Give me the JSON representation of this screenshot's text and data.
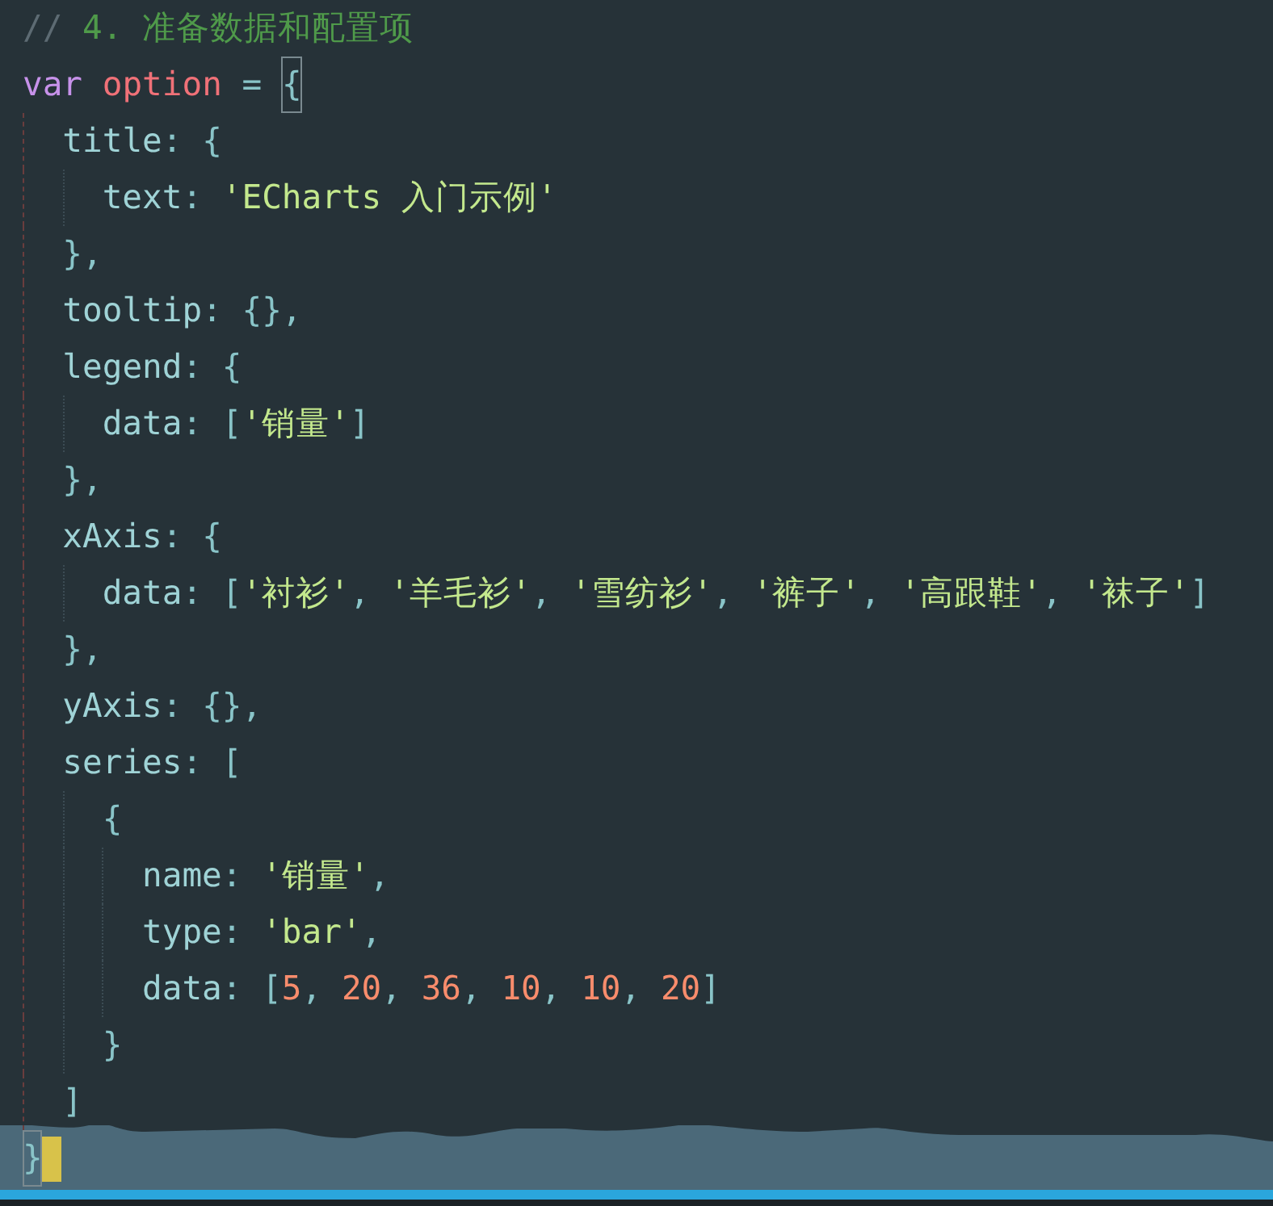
{
  "editor": {
    "lines": [
      {
        "tokens": [
          {
            "kind": "comment-mark",
            "text": "// "
          },
          {
            "kind": "comment",
            "text": "4. 准备数据和配置项"
          }
        ]
      },
      {
        "tokens": [
          {
            "kind": "keyword",
            "text": "var "
          },
          {
            "kind": "variable",
            "text": "option"
          },
          {
            "kind": "punct",
            "text": " = "
          },
          {
            "kind": "punct",
            "text": "{",
            "bracket_match": true
          }
        ],
        "children": [
          {
            "tokens": [
              {
                "kind": "property",
                "text": "title"
              },
              {
                "kind": "punct",
                "text": ": {"
              }
            ],
            "children": [
              {
                "tokens": [
                  {
                    "kind": "property",
                    "text": "text"
                  },
                  {
                    "kind": "punct",
                    "text": ": "
                  },
                  {
                    "kind": "string",
                    "text": "'ECharts 入门示例'"
                  }
                ]
              }
            ],
            "close": {
              "tokens": [
                {
                  "kind": "punct",
                  "text": "},"
                }
              ]
            }
          },
          {
            "tokens": [
              {
                "kind": "property",
                "text": "tooltip"
              },
              {
                "kind": "punct",
                "text": ": {},"
              }
            ]
          },
          {
            "tokens": [
              {
                "kind": "property",
                "text": "legend"
              },
              {
                "kind": "punct",
                "text": ": {"
              }
            ],
            "children": [
              {
                "tokens": [
                  {
                    "kind": "property",
                    "text": "data"
                  },
                  {
                    "kind": "punct",
                    "text": ": ["
                  },
                  {
                    "kind": "string",
                    "text": "'销量'"
                  },
                  {
                    "kind": "punct",
                    "text": "]"
                  }
                ]
              }
            ],
            "close": {
              "tokens": [
                {
                  "kind": "punct",
                  "text": "},"
                }
              ]
            }
          },
          {
            "tokens": [
              {
                "kind": "property",
                "text": "xAxis"
              },
              {
                "kind": "punct",
                "text": ": {"
              }
            ],
            "children": [
              {
                "tokens": [
                  {
                    "kind": "property",
                    "text": "data"
                  },
                  {
                    "kind": "punct",
                    "text": ": ["
                  },
                  {
                    "kind": "string",
                    "text": "'衬衫'"
                  },
                  {
                    "kind": "punct",
                    "text": ", "
                  },
                  {
                    "kind": "string",
                    "text": "'羊毛衫'"
                  },
                  {
                    "kind": "punct",
                    "text": ", "
                  },
                  {
                    "kind": "string",
                    "text": "'雪纺衫'"
                  },
                  {
                    "kind": "punct",
                    "text": ", "
                  },
                  {
                    "kind": "string",
                    "text": "'裤子'"
                  },
                  {
                    "kind": "punct",
                    "text": ", "
                  },
                  {
                    "kind": "string",
                    "text": "'高跟鞋'"
                  },
                  {
                    "kind": "punct",
                    "text": ", "
                  },
                  {
                    "kind": "string",
                    "text": "'袜子'"
                  },
                  {
                    "kind": "punct",
                    "text": "]"
                  }
                ]
              }
            ],
            "close": {
              "tokens": [
                {
                  "kind": "punct",
                  "text": "},"
                }
              ]
            }
          },
          {
            "tokens": [
              {
                "kind": "property",
                "text": "yAxis"
              },
              {
                "kind": "punct",
                "text": ": {},"
              }
            ]
          },
          {
            "tokens": [
              {
                "kind": "property",
                "text": "series"
              },
              {
                "kind": "punct",
                "text": ": ["
              }
            ],
            "children": [
              {
                "tokens": [
                  {
                    "kind": "punct",
                    "text": "{"
                  }
                ],
                "children": [
                  {
                    "tokens": [
                      {
                        "kind": "property",
                        "text": "name"
                      },
                      {
                        "kind": "punct",
                        "text": ": "
                      },
                      {
                        "kind": "string",
                        "text": "'销量'"
                      },
                      {
                        "kind": "punct",
                        "text": ","
                      }
                    ]
                  },
                  {
                    "tokens": [
                      {
                        "kind": "property",
                        "text": "type"
                      },
                      {
                        "kind": "punct",
                        "text": ": "
                      },
                      {
                        "kind": "string",
                        "text": "'bar'"
                      },
                      {
                        "kind": "punct",
                        "text": ","
                      }
                    ]
                  },
                  {
                    "tokens": [
                      {
                        "kind": "property",
                        "text": "data"
                      },
                      {
                        "kind": "punct",
                        "text": ": ["
                      },
                      {
                        "kind": "number",
                        "text": "5"
                      },
                      {
                        "kind": "punct",
                        "text": ", "
                      },
                      {
                        "kind": "number",
                        "text": "20"
                      },
                      {
                        "kind": "punct",
                        "text": ", "
                      },
                      {
                        "kind": "number",
                        "text": "36"
                      },
                      {
                        "kind": "punct",
                        "text": ", "
                      },
                      {
                        "kind": "number",
                        "text": "10"
                      },
                      {
                        "kind": "punct",
                        "text": ", "
                      },
                      {
                        "kind": "number",
                        "text": "10"
                      },
                      {
                        "kind": "punct",
                        "text": ", "
                      },
                      {
                        "kind": "number",
                        "text": "20"
                      },
                      {
                        "kind": "punct",
                        "text": "]"
                      }
                    ]
                  }
                ],
                "close": {
                  "tokens": [
                    {
                      "kind": "punct",
                      "text": "}"
                    }
                  ]
                }
              }
            ],
            "close": {
              "tokens": [
                {
                  "kind": "punct",
                  "text": "]"
                }
              ]
            }
          }
        ],
        "close": {
          "tokens": [
            {
              "kind": "punct",
              "text": "}",
              "bracket_match": true
            }
          ],
          "cursor": true
        }
      }
    ]
  }
}
